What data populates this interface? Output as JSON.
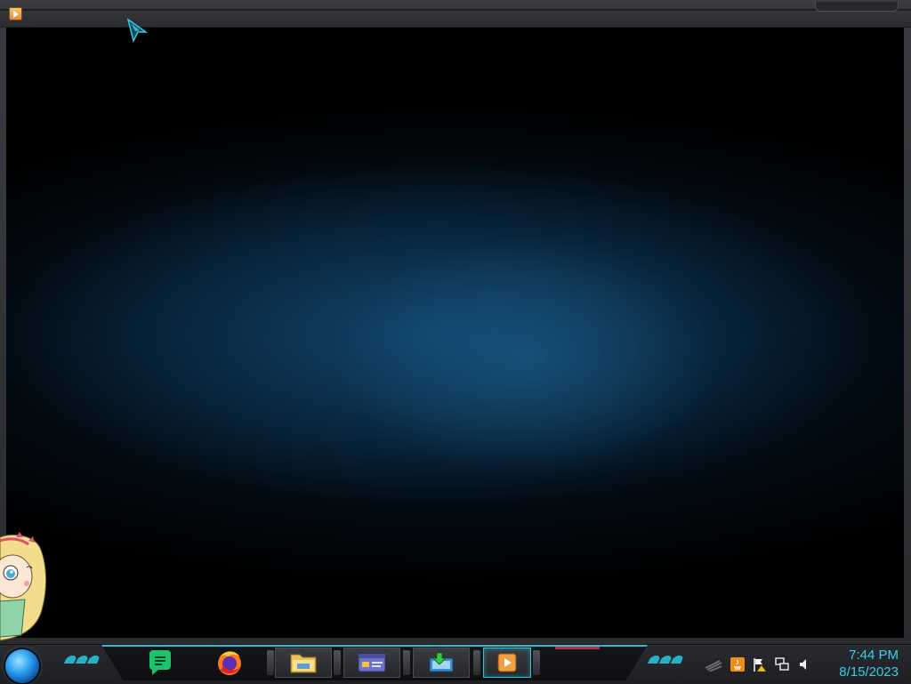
{
  "window": {
    "icon": "media-player-icon"
  },
  "desktop": {
    "cursor": "cursor-arrow-icon",
    "mascot": "mascot-character-image"
  },
  "taskbar": {
    "start_icon": "start-orb-icon",
    "pinned": [
      {
        "name": "notes-app-icon",
        "color": "#1dc36a"
      },
      {
        "name": "firefox-icon",
        "color": "#ff7a1f"
      }
    ],
    "windows": [
      {
        "name": "file-explorer-icon",
        "active": false
      },
      {
        "name": "control-panel-icon",
        "active": false
      },
      {
        "name": "network-transfer-icon",
        "active": false
      },
      {
        "name": "media-player-icon",
        "active": true
      }
    ],
    "tray": [
      "show-hidden-icon",
      "java-update-icon",
      "action-center-flag-icon",
      "network-icon",
      "volume-icon"
    ],
    "clock": {
      "time": "7:44 PM",
      "date": "8/15/2023"
    }
  },
  "colors": {
    "accent": "#2fd4e6",
    "frame": "#2a2b30",
    "glow": "#1c608c"
  }
}
